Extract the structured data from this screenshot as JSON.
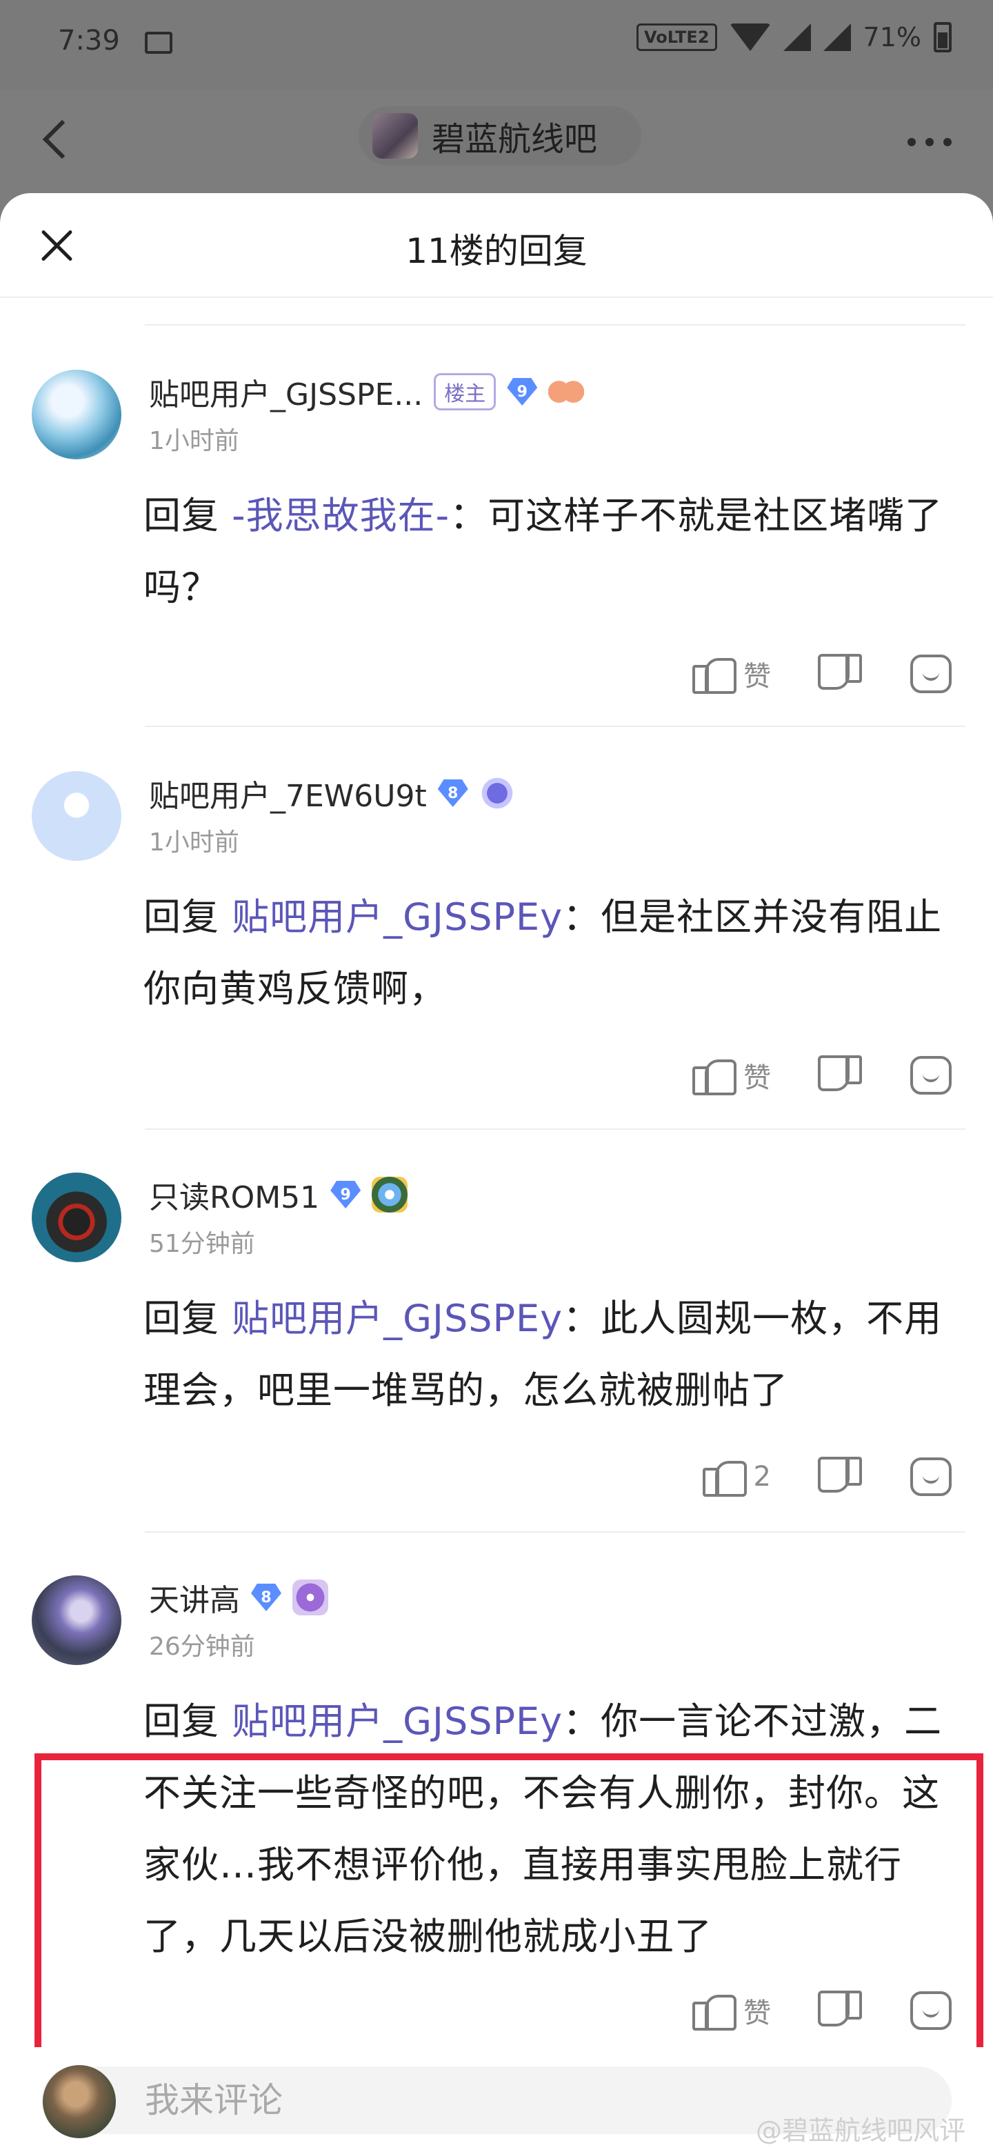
{
  "status_bar": {
    "time": "7:39",
    "network": "VoLTE2",
    "battery": "71%"
  },
  "page_header": {
    "forum_name": "碧蓝航线吧"
  },
  "sheet": {
    "title": "11楼的回复"
  },
  "replies": [
    {
      "username": "贴吧用户_GJSSPE...",
      "badge": "楼主",
      "level": "9",
      "time": "1小时前",
      "reply_prefix": "回复",
      "mention": "-我思故我在-",
      "text": "：可这样子不就是社区堵嘴了吗？",
      "like_label": "赞"
    },
    {
      "username": "贴吧用户_7EW6U9t",
      "level": "8",
      "time": "1小时前",
      "reply_prefix": "回复",
      "mention": "贴吧用户_GJSSPEy",
      "text": "：但是社区并没有阻止你向黄鸡反馈啊，",
      "like_label": "赞"
    },
    {
      "username": "只读ROM51",
      "level": "9",
      "time": "51分钟前",
      "reply_prefix": "回复",
      "mention": "贴吧用户_GJSSPEy",
      "text": "：此人圆规一枚，不用理会，吧里一堆骂的，怎么就被删帖了",
      "like_label": "2"
    },
    {
      "username": "天讲高",
      "level": "8",
      "time": "26分钟前",
      "reply_prefix": "回复",
      "mention": "贴吧用户_GJSSPEy",
      "text": "：你一言论不过激，二不关注一些奇怪的吧，不会有人删你，封你。这家伙…我不想评价他，直接用事实甩脸上就行了，几天以后没被删他就成小丑了",
      "like_label": "赞"
    }
  ],
  "bottom_bar": {
    "placeholder": "我来评论",
    "watermark": "@碧蓝航线吧风评"
  },
  "colors": {
    "mention": "#5b56b8",
    "highlight_border": "#e8243c",
    "overlay": "#7d7d7d"
  }
}
